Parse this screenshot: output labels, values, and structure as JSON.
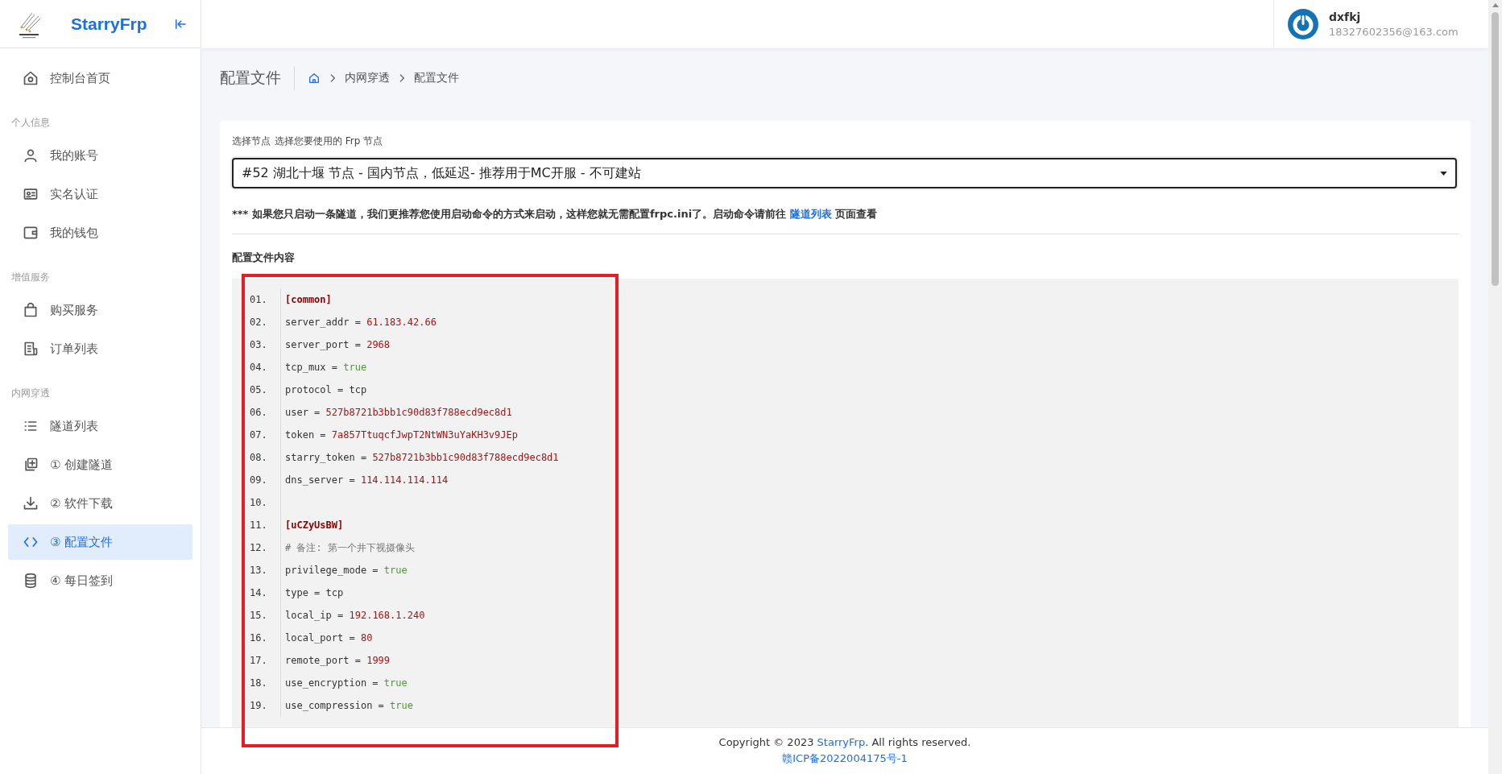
{
  "sidebar": {
    "brand": "StarryFrp",
    "sections": [
      {
        "items": [
          {
            "label": "控制台首页",
            "selected": false
          }
        ]
      },
      {
        "heading": "个人信息",
        "items": [
          {
            "label": "我的账号",
            "selected": false
          },
          {
            "label": "实名认证",
            "selected": false
          },
          {
            "label": "我的钱包",
            "selected": false
          }
        ]
      },
      {
        "heading": "增值服务",
        "items": [
          {
            "label": "购买服务",
            "selected": false
          },
          {
            "label": "订单列表",
            "selected": false
          }
        ]
      },
      {
        "heading": "内网穿透",
        "items": [
          {
            "label": "隧道列表",
            "selected": false
          },
          {
            "label": "① 创建隧道",
            "selected": false
          },
          {
            "label": "② 软件下载",
            "selected": false
          },
          {
            "label": "③ 配置文件",
            "selected": true
          },
          {
            "label": "④ 每日签到",
            "selected": false
          }
        ]
      }
    ]
  },
  "user": {
    "name": "dxfkj",
    "email": "18327602356@163.com"
  },
  "page_title": "配置文件",
  "breadcrumb": [
    "内网穿透",
    "配置文件"
  ],
  "node_select": {
    "label": "选择节点",
    "hint": "选择您要使用的 Frp 节点",
    "value": "#52 湖北十堰 节点 - 国内节点，低延迟- 推荐用于MC开服 - 不可建站"
  },
  "notice": {
    "text": "*** 如果您只启动一条隧道，我们更推荐您使用启动命令的方式来启动，这样您就无需配置frpc.ini了。启动命令请前往",
    "link": "隧道列表",
    "after": "页面查看"
  },
  "config_heading": "配置文件内容",
  "config_lines": [
    {
      "number": "01.",
      "parts": [
        {
          "kind": "section",
          "text": "[common]"
        }
      ]
    },
    {
      "number": "02.",
      "parts": [
        {
          "kind": "plain",
          "text": "server_addr = "
        },
        {
          "kind": "value",
          "text": "61.183.42.66"
        }
      ]
    },
    {
      "number": "03.",
      "parts": [
        {
          "kind": "plain",
          "text": "server_port = "
        },
        {
          "kind": "value",
          "text": "2968"
        }
      ]
    },
    {
      "number": "04.",
      "parts": [
        {
          "kind": "plain",
          "text": "tcp_mux = "
        },
        {
          "kind": "bool",
          "text": "true"
        }
      ]
    },
    {
      "number": "05.",
      "parts": [
        {
          "kind": "plain",
          "text": "protocol = tcp"
        }
      ]
    },
    {
      "number": "06.",
      "parts": [
        {
          "kind": "plain",
          "text": "user = "
        },
        {
          "kind": "value",
          "text": "527b8721b3bb1c90d83f788ecd9ec8d1"
        }
      ]
    },
    {
      "number": "07.",
      "parts": [
        {
          "kind": "plain",
          "text": "token = "
        },
        {
          "kind": "value",
          "text": "7a857TtuqcfJwpT2NtWN3uYaKH3v9JEp"
        }
      ]
    },
    {
      "number": "08.",
      "parts": [
        {
          "kind": "plain",
          "text": "starry_token = "
        },
        {
          "kind": "value",
          "text": "527b8721b3bb1c90d83f788ecd9ec8d1"
        }
      ]
    },
    {
      "number": "09.",
      "parts": [
        {
          "kind": "plain",
          "text": "dns_server = "
        },
        {
          "kind": "value",
          "text": "114.114.114.114"
        }
      ]
    },
    {
      "number": "10."
    },
    {
      "number": "11.",
      "parts": [
        {
          "kind": "section",
          "text": "[uCZyUsBW]"
        }
      ]
    },
    {
      "number": "12.",
      "parts": [
        {
          "kind": "comment",
          "text": "# 备注: 第一个井下视摄像头"
        }
      ]
    },
    {
      "number": "13.",
      "parts": [
        {
          "kind": "plain",
          "text": "privilege_mode = "
        },
        {
          "kind": "bool",
          "text": "true"
        }
      ]
    },
    {
      "number": "14.",
      "parts": [
        {
          "kind": "plain",
          "text": "type = tcp"
        }
      ]
    },
    {
      "number": "15.",
      "parts": [
        {
          "kind": "plain",
          "text": "local_ip = "
        },
        {
          "kind": "value",
          "text": "192.168.1.240"
        }
      ]
    },
    {
      "number": "16.",
      "parts": [
        {
          "kind": "plain",
          "text": "local_port = "
        },
        {
          "kind": "value",
          "text": "80"
        }
      ]
    },
    {
      "number": "17.",
      "parts": [
        {
          "kind": "plain",
          "text": "remote_port = "
        },
        {
          "kind": "value",
          "text": "1999"
        }
      ]
    },
    {
      "number": "18.",
      "parts": [
        {
          "kind": "plain",
          "text": "use_encryption = "
        },
        {
          "kind": "bool",
          "text": "true"
        }
      ]
    },
    {
      "number": "19.",
      "parts": [
        {
          "kind": "plain",
          "text": "use_compression = "
        },
        {
          "kind": "bool",
          "text": "true"
        }
      ]
    }
  ],
  "footer": {
    "text": "Copyright © 2023",
    "link": "StarryFrp",
    "after": ". All rights reserved.",
    "icp": "赣ICP备2022004175号-1"
  },
  "annotations": [
    {
      "kind": "rectangle"
    }
  ]
}
